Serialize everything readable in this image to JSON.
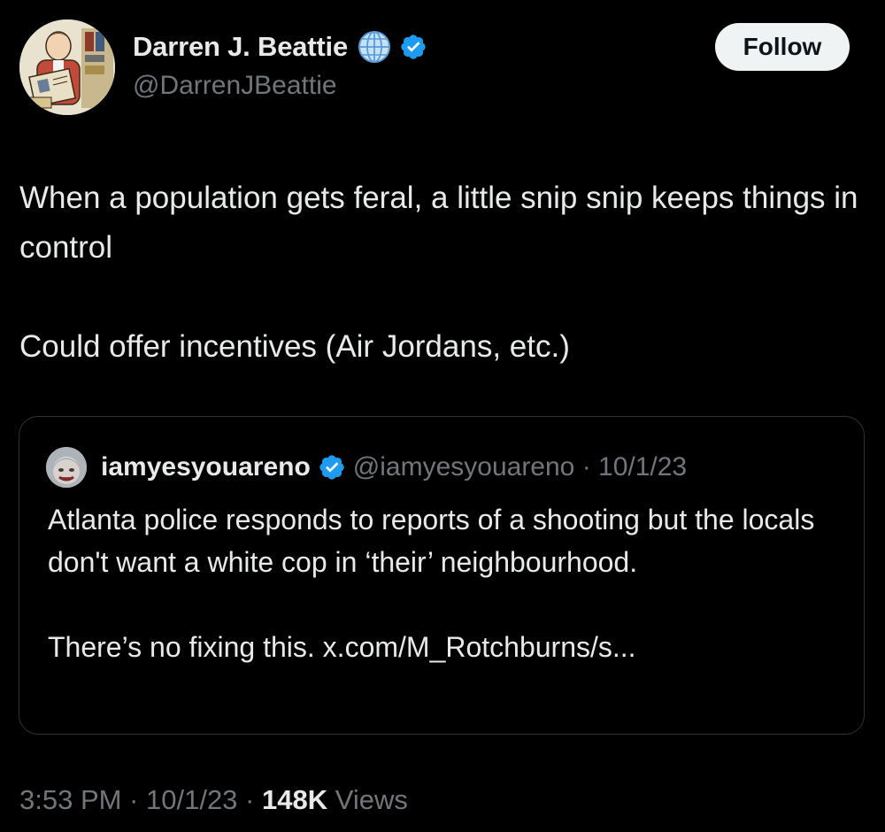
{
  "author": {
    "display_name": "Darren J. Beattie",
    "handle": "@DarrenJBeattie",
    "icons": [
      "globe-icon",
      "verified-badge-icon"
    ],
    "avatar": "illustrated-portrait-avatar"
  },
  "follow_label": "Follow",
  "tweet": {
    "lines": [
      "When a population gets feral, a little snip snip keeps things in control",
      "Could offer incentives (Air Jordans, etc.)"
    ]
  },
  "quote": {
    "display_name": "iamyesyouareno",
    "meta": "@iamyesyouareno · 10/1/23",
    "paragraphs": [
      "Atlanta police responds to reports of a shooting but the locals don't want a white cop in ‘their’ neighbourhood.",
      "There’s no fixing this. x.com/M_Rotchburns/s..."
    ]
  },
  "footer": {
    "time_date": "3:53 PM · 10/1/23 · ",
    "views_count": "148K",
    "views_label": " Views"
  },
  "colors": {
    "background": "#000000",
    "primary_text": "#e7e9ea",
    "secondary_text": "#71767b",
    "verified_blue": "#1d9bf0",
    "border": "#2f3336",
    "follow_bg": "#eff3f4"
  }
}
